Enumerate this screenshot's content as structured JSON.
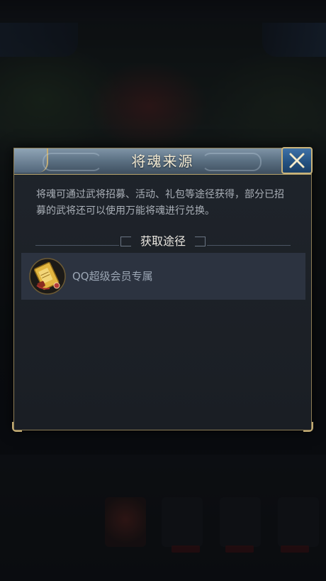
{
  "dialog": {
    "title": "将魂来源",
    "description": "将魂可通过武将招募、活动、礼包等途径获得，部分已招募的武将还可以使用万能将魂进行兑换。",
    "section_title": "获取途径",
    "sources": [
      {
        "label": "QQ超级会员专属",
        "icon": "scroll-icon"
      }
    ],
    "close_icon": "close-icon"
  },
  "colors": {
    "accent_gold": "#c9b37a",
    "title_text": "#f3ead2",
    "body_text": "#a9afb7",
    "item_bg": "#2c3340",
    "close_button_blue": "#2f5f92"
  }
}
